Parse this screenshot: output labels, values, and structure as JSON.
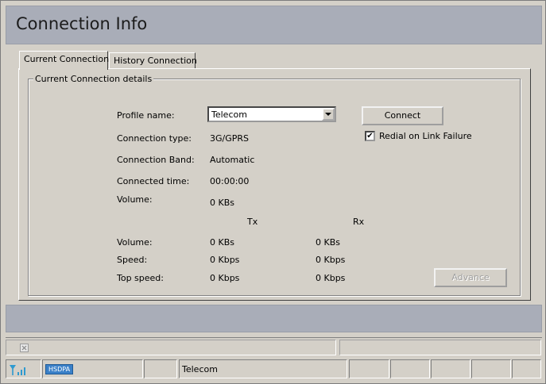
{
  "window": {
    "title": "Connection Info"
  },
  "tabs": [
    {
      "label": "Current Connection",
      "active": true
    },
    {
      "label": "History Connection",
      "active": false
    }
  ],
  "group": {
    "legend": "Current Connection details"
  },
  "profile": {
    "label": "Profile name:",
    "value": "Telecom"
  },
  "fields": {
    "connection_type": {
      "label": "Connection type:",
      "value": "3G/GPRS"
    },
    "connection_band": {
      "label": "Connection Band:",
      "value": "Automatic"
    },
    "connected_time": {
      "label": "Connected time:",
      "value": "00:00:00"
    },
    "volume_total": {
      "label": "Volume:",
      "value": "0 KBs"
    }
  },
  "table": {
    "tx_header": "Tx",
    "rx_header": "Rx",
    "rows": [
      {
        "label": "Volume:",
        "tx": "0 KBs",
        "rx": "0 KBs"
      },
      {
        "label": "Speed:",
        "tx": "0 Kbps",
        "rx": "0 Kbps"
      },
      {
        "label": "Top speed:",
        "tx": "0 Kbps",
        "rx": "0 Kbps"
      }
    ]
  },
  "buttons": {
    "connect": "Connect",
    "advance": "Advance"
  },
  "redial": {
    "label": "Redial on Link Failure",
    "checked": true,
    "mark": "✔"
  },
  "statusbar": {
    "network_type": "HSDPA",
    "operator": "Telecom"
  },
  "icons": {
    "signal": "signal-strength-icon",
    "close": "close-icon"
  },
  "colors": {
    "header_bg": "#a9adb8",
    "badge_bg": "#3a80c8",
    "signal": "#2e9ad0"
  }
}
